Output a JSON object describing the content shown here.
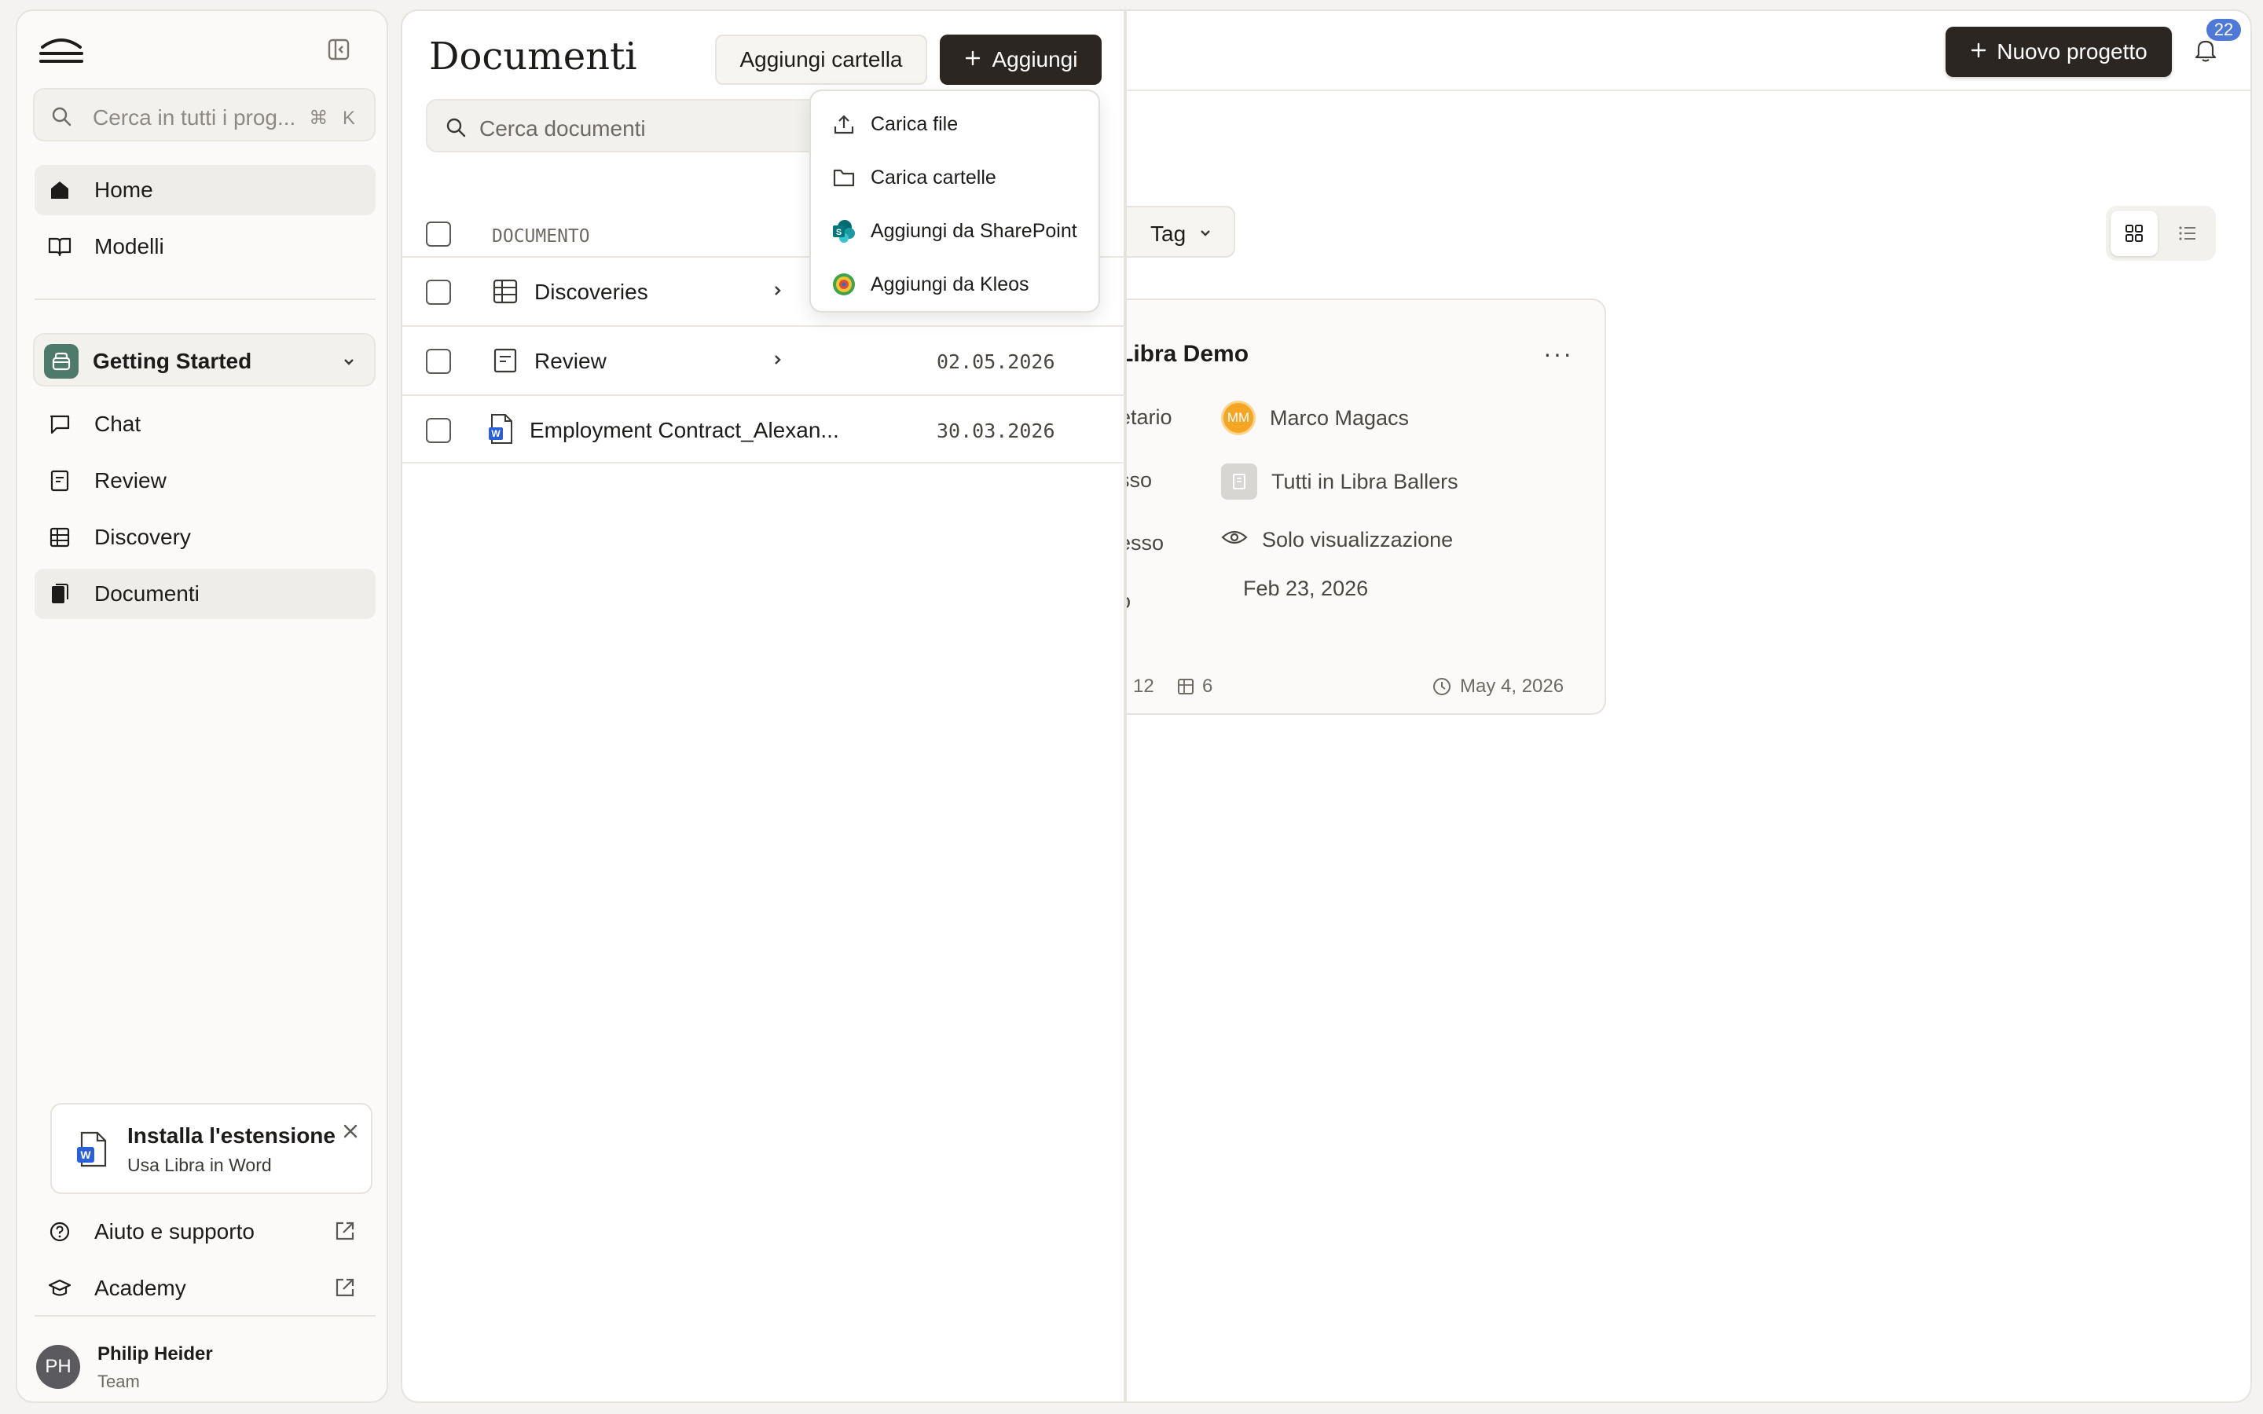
{
  "sidebar": {
    "search_placeholder": "Cerca in tutti i prog...",
    "search_shortcut": "⌘ K",
    "nav": [
      {
        "label": "Home",
        "icon": "home-icon"
      },
      {
        "label": "Modelli",
        "icon": "book-icon"
      }
    ],
    "project": {
      "name": "Getting Started"
    },
    "project_nav": [
      {
        "label": "Chat",
        "icon": "chat-icon"
      },
      {
        "label": "Review",
        "icon": "review-icon"
      },
      {
        "label": "Discovery",
        "icon": "table-icon"
      },
      {
        "label": "Documenti",
        "icon": "documents-icon"
      }
    ],
    "extension": {
      "title": "Installa l'estensione",
      "subtitle": "Usa Libra in Word"
    },
    "footer_links": [
      {
        "label": "Aiuto e supporto"
      },
      {
        "label": "Academy"
      }
    ],
    "user": {
      "initials": "PH",
      "name": "Philip Heider",
      "role": "Team"
    }
  },
  "header": {
    "new_project_label": "Nuovo progetto",
    "notifications_count": "22"
  },
  "filters": {
    "tag_label": "Tag"
  },
  "project_card": {
    "title": "Libra Demo",
    "rows": [
      {
        "key": "etario",
        "value": "Marco Magacs",
        "badge": "MM"
      },
      {
        "key": "sso",
        "value": "Tutti in Libra Ballers"
      },
      {
        "key": "esso",
        "value": "Solo visualizzazione"
      },
      {
        "key": "o",
        "value": "Feb 23, 2026"
      }
    ],
    "reviews_count": "12",
    "tables_count": "6",
    "updated": "May 4, 2026",
    "more": "···"
  },
  "documents": {
    "title": "Documenti",
    "add_folder_label": "Aggiungi cartella",
    "add_label": "Aggiungi",
    "search_placeholder": "Cerca documenti",
    "column_document": "DOCUMENTO",
    "rows": [
      {
        "name": "Discoveries",
        "date": "",
        "type": "table"
      },
      {
        "name": "Review",
        "date": "02.05.2026",
        "type": "review"
      },
      {
        "name": "Employment Contract_Alexan...",
        "date": "30.03.2026",
        "type": "word"
      }
    ]
  },
  "add_menu": {
    "items": [
      {
        "label": "Carica file",
        "icon": "upload-icon"
      },
      {
        "label": "Carica cartelle",
        "icon": "folder-icon"
      },
      {
        "label": "Aggiungi da SharePoint",
        "icon": "sharepoint-icon"
      },
      {
        "label": "Aggiungi da Kleos",
        "icon": "kleos-icon"
      }
    ]
  }
}
